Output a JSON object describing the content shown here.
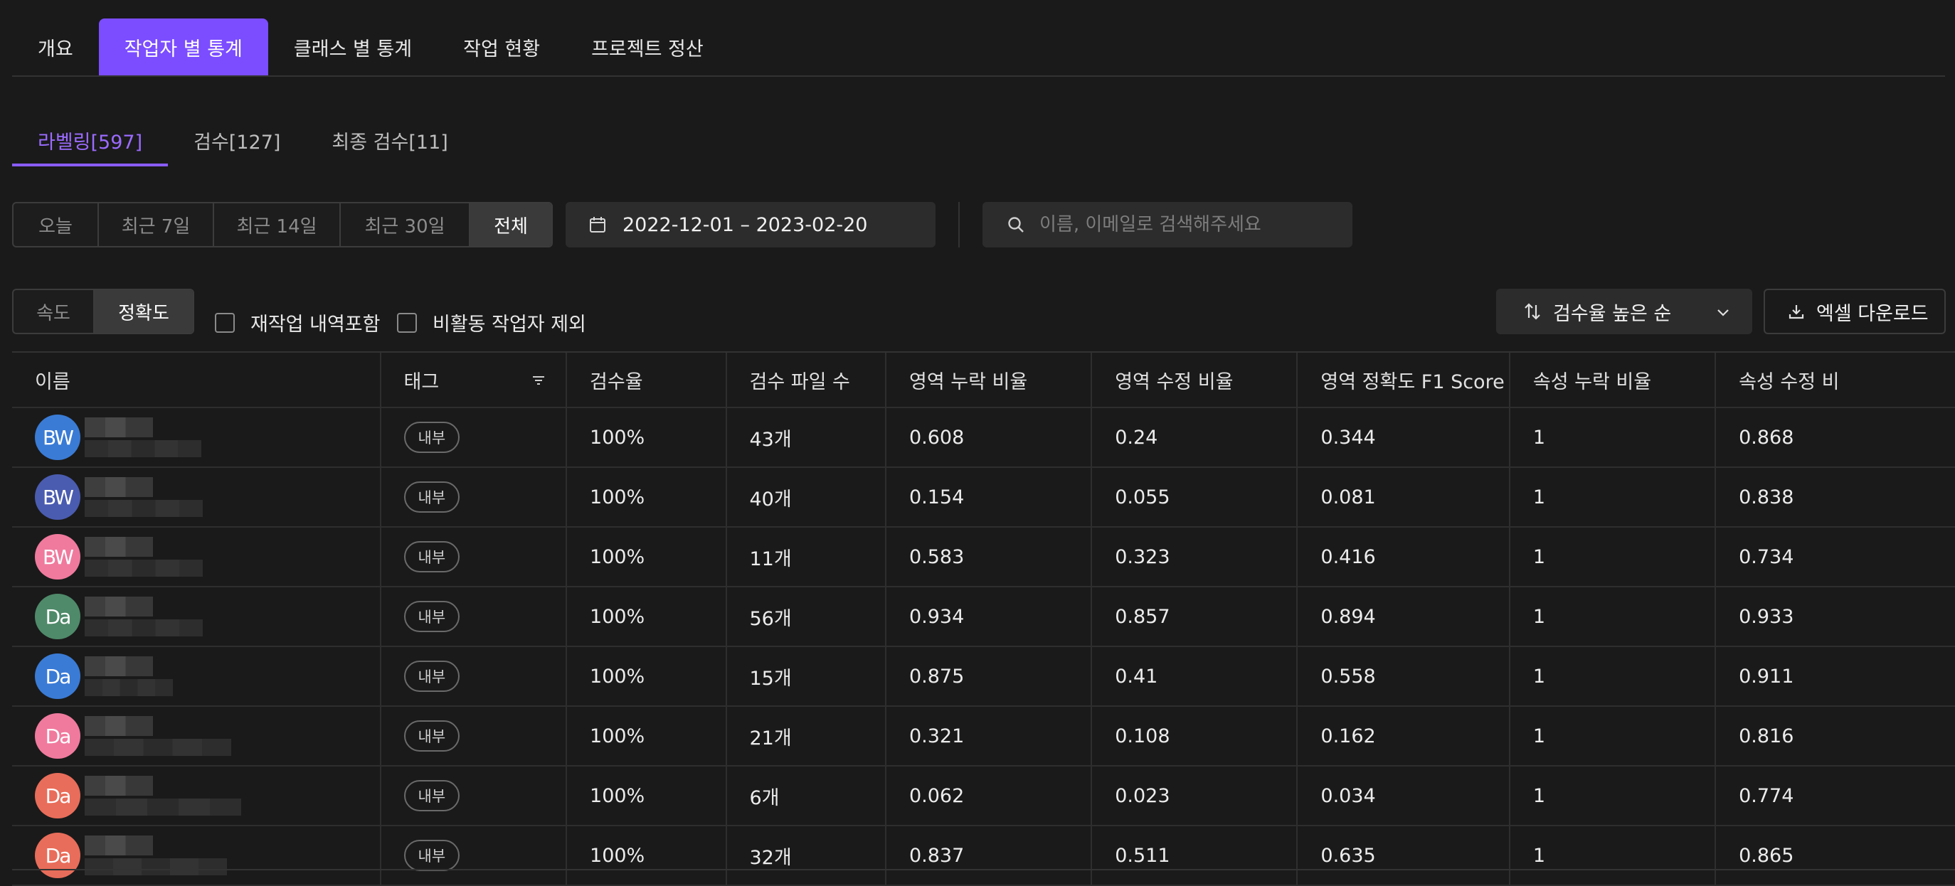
{
  "top_tabs": [
    "개요",
    "작업자 별 통계",
    "클래스 별 통계",
    "작업 현황",
    "프로젝트 정산"
  ],
  "top_tab_active": 1,
  "sub_tabs": [
    "라벨링[597]",
    "검수[127]",
    "최종 검수[11]"
  ],
  "sub_tab_active": 0,
  "range_buttons": [
    "오늘",
    "최근 7일",
    "최근 14일",
    "최근 30일",
    "전체"
  ],
  "range_active": 4,
  "date_range": "2022-12-01 – 2023-02-20",
  "search": {
    "placeholder": "이름, 이메일로 검색해주세요",
    "value": ""
  },
  "metric_toggle": [
    "속도",
    "정확도"
  ],
  "metric_active": 1,
  "checkboxes": [
    {
      "label": "재작업 내역포함",
      "checked": false
    },
    {
      "label": "비활동 작업자 제외",
      "checked": false
    }
  ],
  "sort_label": "검수율 높은 순",
  "excel_label": "엑셀 다운로드",
  "table": {
    "columns": [
      "이름",
      "태그",
      "검수율",
      "검수 파일 수",
      "영역 누락 비율",
      "영역 수정 비율",
      "영역 정확도 F1 Score",
      "속성 누락 비율",
      "속성 수정 비"
    ],
    "rows": [
      {
        "initials": "BW",
        "avatar_color": "#3a7bd5",
        "tag": "내부",
        "rate": "100%",
        "files": "43개",
        "miss": "0.608",
        "fix": "0.24",
        "f1": "0.344",
        "amiss": "1",
        "afix": "0.868"
      },
      {
        "initials": "BW",
        "avatar_color": "#4a5cb0",
        "tag": "내부",
        "rate": "100%",
        "files": "40개",
        "miss": "0.154",
        "fix": "0.055",
        "f1": "0.081",
        "amiss": "1",
        "afix": "0.838"
      },
      {
        "initials": "BW",
        "avatar_color": "#f07a9e",
        "tag": "내부",
        "rate": "100%",
        "files": "11개",
        "miss": "0.583",
        "fix": "0.323",
        "f1": "0.416",
        "amiss": "1",
        "afix": "0.734"
      },
      {
        "initials": "Da",
        "avatar_color": "#4f8a6a",
        "tag": "내부",
        "rate": "100%",
        "files": "56개",
        "miss": "0.934",
        "fix": "0.857",
        "f1": "0.894",
        "amiss": "1",
        "afix": "0.933"
      },
      {
        "initials": "Da",
        "avatar_color": "#3a7bd5",
        "tag": "내부",
        "rate": "100%",
        "files": "15개",
        "miss": "0.875",
        "fix": "0.41",
        "f1": "0.558",
        "amiss": "1",
        "afix": "0.911"
      },
      {
        "initials": "Da",
        "avatar_color": "#f07a9e",
        "tag": "내부",
        "rate": "100%",
        "files": "21개",
        "miss": "0.321",
        "fix": "0.108",
        "f1": "0.162",
        "amiss": "1",
        "afix": "0.816"
      },
      {
        "initials": "Da",
        "avatar_color": "#e86d5a",
        "tag": "내부",
        "rate": "100%",
        "files": "6개",
        "miss": "0.062",
        "fix": "0.023",
        "f1": "0.034",
        "amiss": "1",
        "afix": "0.774"
      },
      {
        "initials": "Da",
        "avatar_color": "#e86d5a",
        "tag": "내부",
        "rate": "100%",
        "files": "32개",
        "miss": "0.837",
        "fix": "0.511",
        "f1": "0.635",
        "amiss": "1",
        "afix": "0.865"
      }
    ]
  }
}
